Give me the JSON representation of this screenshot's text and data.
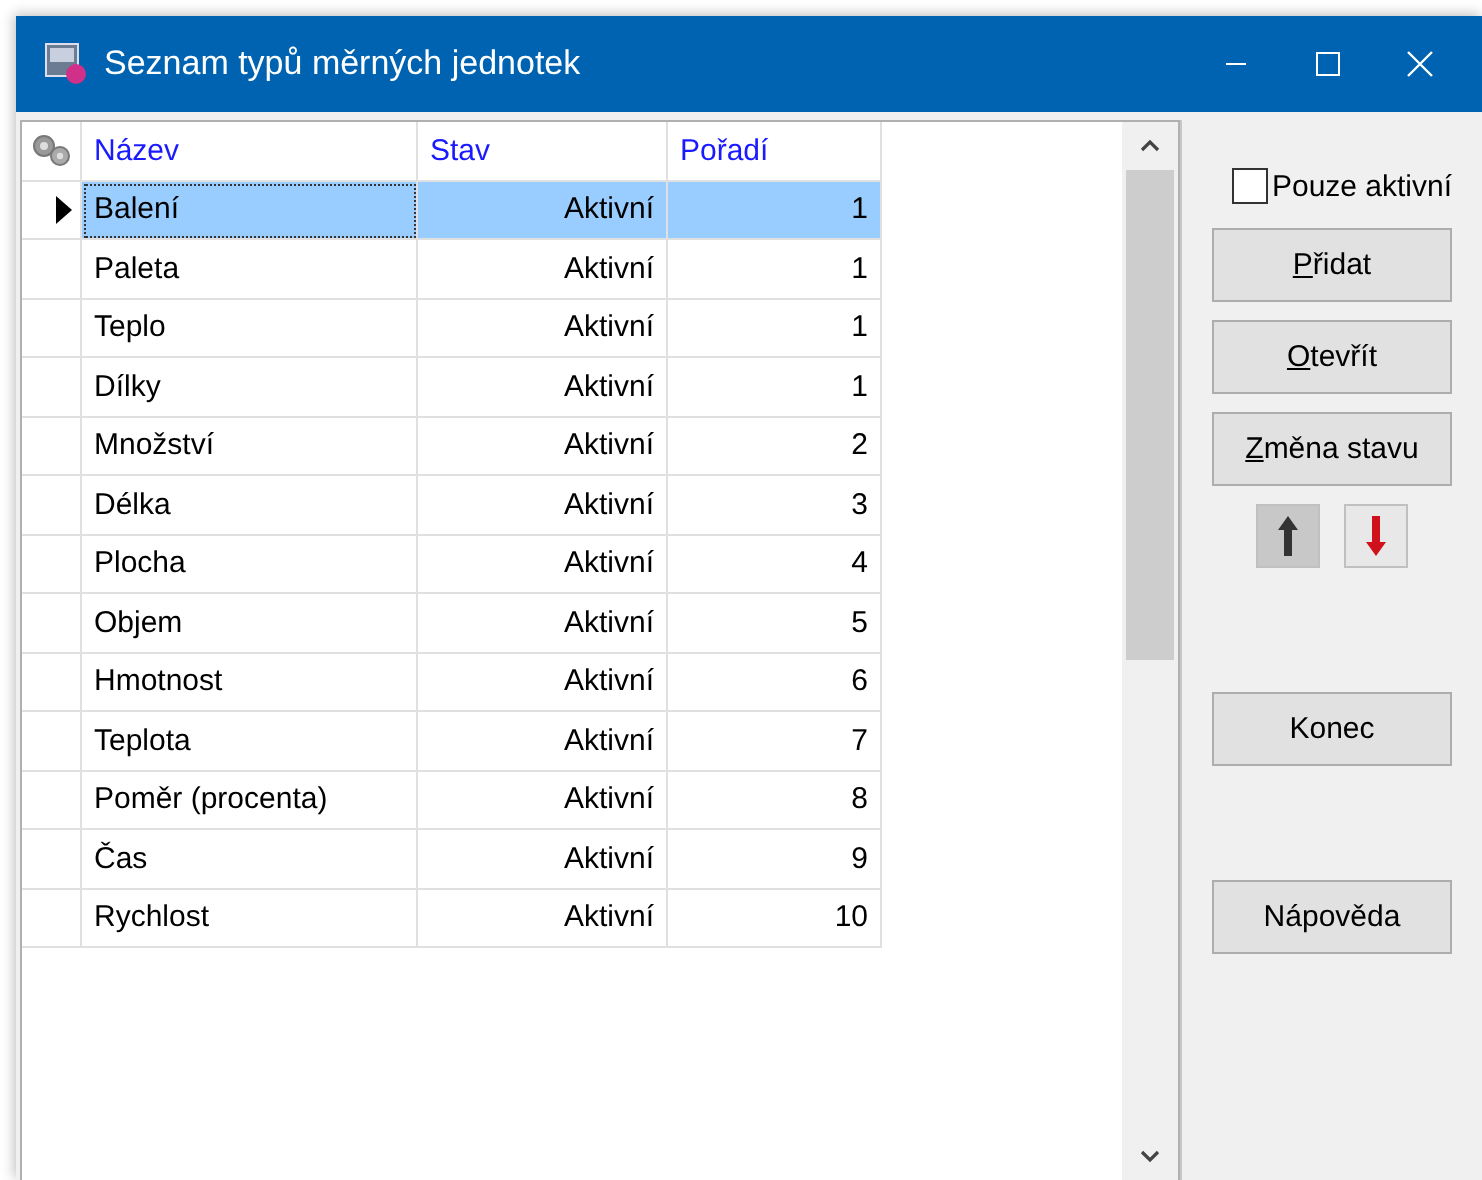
{
  "window": {
    "title": "Seznam typů měrných jednotek"
  },
  "table": {
    "columns": [
      "Název",
      "Stav",
      "Pořadí"
    ],
    "rows": [
      {
        "cells": [
          "Balení",
          "Aktivní",
          "1"
        ],
        "selected": true
      },
      {
        "cells": [
          "Paleta",
          "Aktivní",
          "1"
        ],
        "selected": false
      },
      {
        "cells": [
          "Teplo",
          "Aktivní",
          "1"
        ],
        "selected": false
      },
      {
        "cells": [
          "Dílky",
          "Aktivní",
          "1"
        ],
        "selected": false
      },
      {
        "cells": [
          "Množství",
          "Aktivní",
          "2"
        ],
        "selected": false
      },
      {
        "cells": [
          "Délka",
          "Aktivní",
          "3"
        ],
        "selected": false
      },
      {
        "cells": [
          "Plocha",
          "Aktivní",
          "4"
        ],
        "selected": false
      },
      {
        "cells": [
          "Objem",
          "Aktivní",
          "5"
        ],
        "selected": false
      },
      {
        "cells": [
          "Hmotnost",
          "Aktivní",
          "6"
        ],
        "selected": false
      },
      {
        "cells": [
          "Teplota",
          "Aktivní",
          "7"
        ],
        "selected": false
      },
      {
        "cells": [
          "Poměr (procenta)",
          "Aktivní",
          "8"
        ],
        "selected": false
      },
      {
        "cells": [
          "Čas",
          "Aktivní",
          "9"
        ],
        "selected": false
      },
      {
        "cells": [
          "Rychlost",
          "Aktivní",
          "10"
        ],
        "selected": false
      }
    ]
  },
  "filter": {
    "label": "Pouze aktivní",
    "checked": false
  },
  "buttons": [
    {
      "label": "Přidat",
      "mnemonic_first": true
    },
    {
      "label": "Otevřít",
      "mnemonic_first": true
    },
    {
      "label": "Změna stavu",
      "mnemonic_first": true
    }
  ],
  "bottom_buttons": [
    {
      "label": "Konec",
      "mnemonic_first": false
    },
    {
      "label": "Nápověda",
      "mnemonic_first": false
    }
  ]
}
